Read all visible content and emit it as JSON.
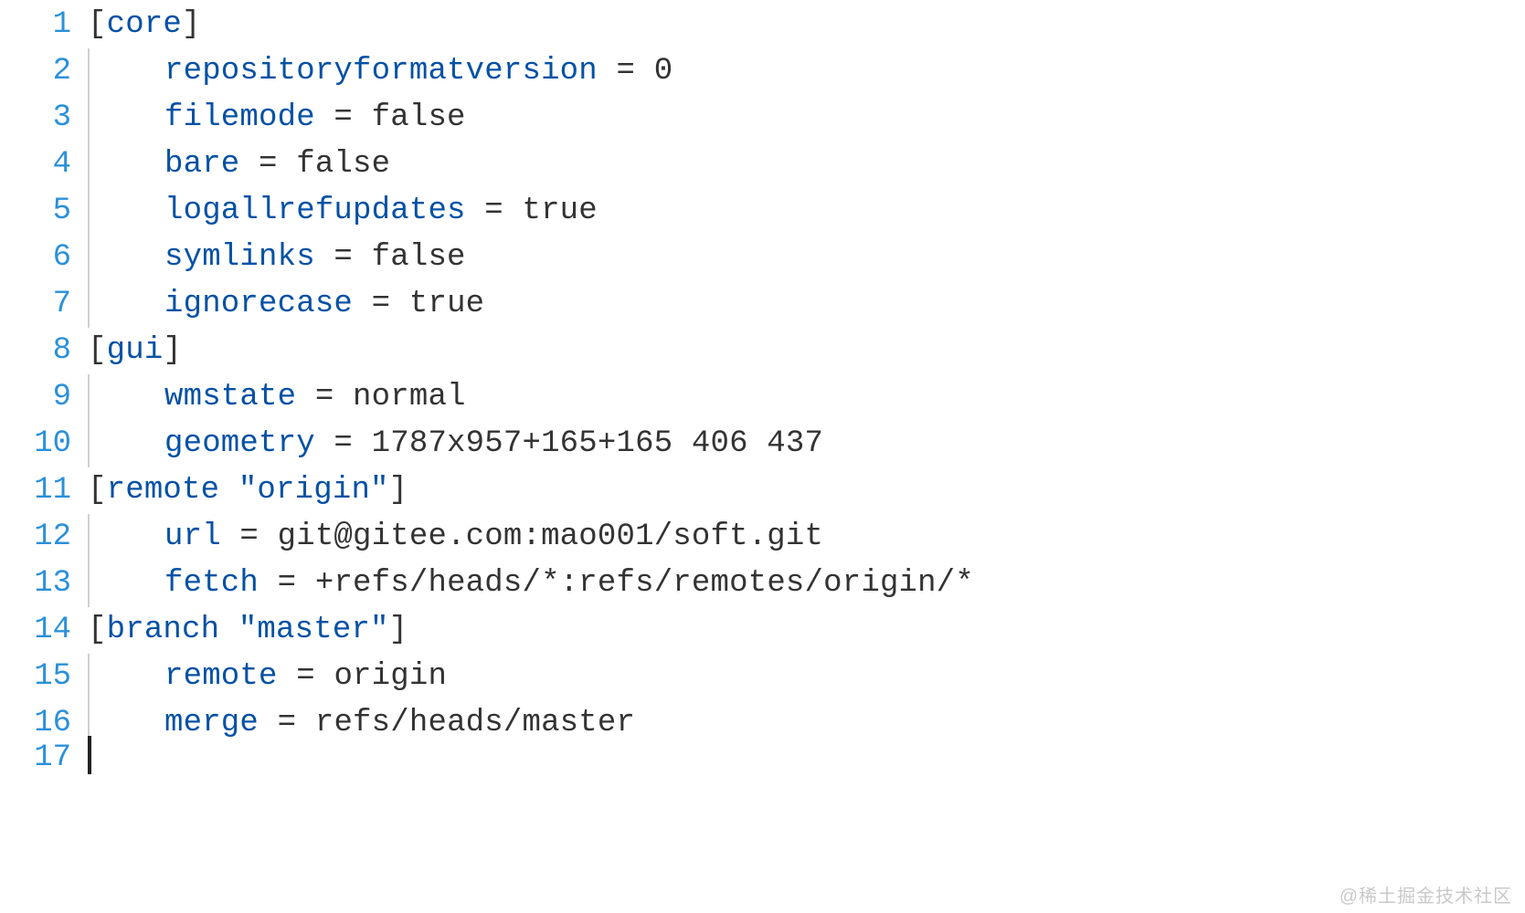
{
  "watermark": "@稀土掘金技术社区",
  "config": {
    "sections": {
      "core": {
        "repositoryformatversion": "0",
        "filemode": "false",
        "bare": "false",
        "logallrefupdates": "true",
        "symlinks": "false",
        "ignorecase": "true"
      },
      "gui": {
        "wmstate": "normal",
        "geometry": "1787x957+165+165 406 437"
      },
      "remote \"origin\"": {
        "url": "git@gitee.com:mao001/soft.git",
        "fetch": "+refs/heads/*:refs/remotes/origin/*"
      },
      "branch \"master\"": {
        "remote": "origin",
        "merge": "refs/heads/master"
      }
    }
  },
  "lines": [
    {
      "n": 1,
      "type": "section",
      "name": "core"
    },
    {
      "n": 2,
      "type": "kv",
      "key": "repositoryformatversion",
      "value": "0"
    },
    {
      "n": 3,
      "type": "kv",
      "key": "filemode",
      "value": "false"
    },
    {
      "n": 4,
      "type": "kv",
      "key": "bare",
      "value": "false"
    },
    {
      "n": 5,
      "type": "kv",
      "key": "logallrefupdates",
      "value": "true"
    },
    {
      "n": 6,
      "type": "kv",
      "key": "symlinks",
      "value": "false"
    },
    {
      "n": 7,
      "type": "kv",
      "key": "ignorecase",
      "value": "true"
    },
    {
      "n": 8,
      "type": "section",
      "name": "gui"
    },
    {
      "n": 9,
      "type": "kv",
      "key": "wmstate",
      "value": "normal"
    },
    {
      "n": 10,
      "type": "kv",
      "key": "geometry",
      "value": "1787x957+165+165 406 437"
    },
    {
      "n": 11,
      "type": "section",
      "name": "remote \"origin\""
    },
    {
      "n": 12,
      "type": "kv",
      "key": "url",
      "value": "git@gitee.com:mao001/soft.git"
    },
    {
      "n": 13,
      "type": "kv",
      "key": "fetch",
      "value": "+refs/heads/*:refs/remotes/origin/*"
    },
    {
      "n": 14,
      "type": "section",
      "name": "branch \"master\""
    },
    {
      "n": 15,
      "type": "kv",
      "key": "remote",
      "value": "origin"
    },
    {
      "n": 16,
      "type": "kv",
      "key": "merge",
      "value": "refs/heads/master"
    },
    {
      "n": 17,
      "type": "empty"
    }
  ]
}
